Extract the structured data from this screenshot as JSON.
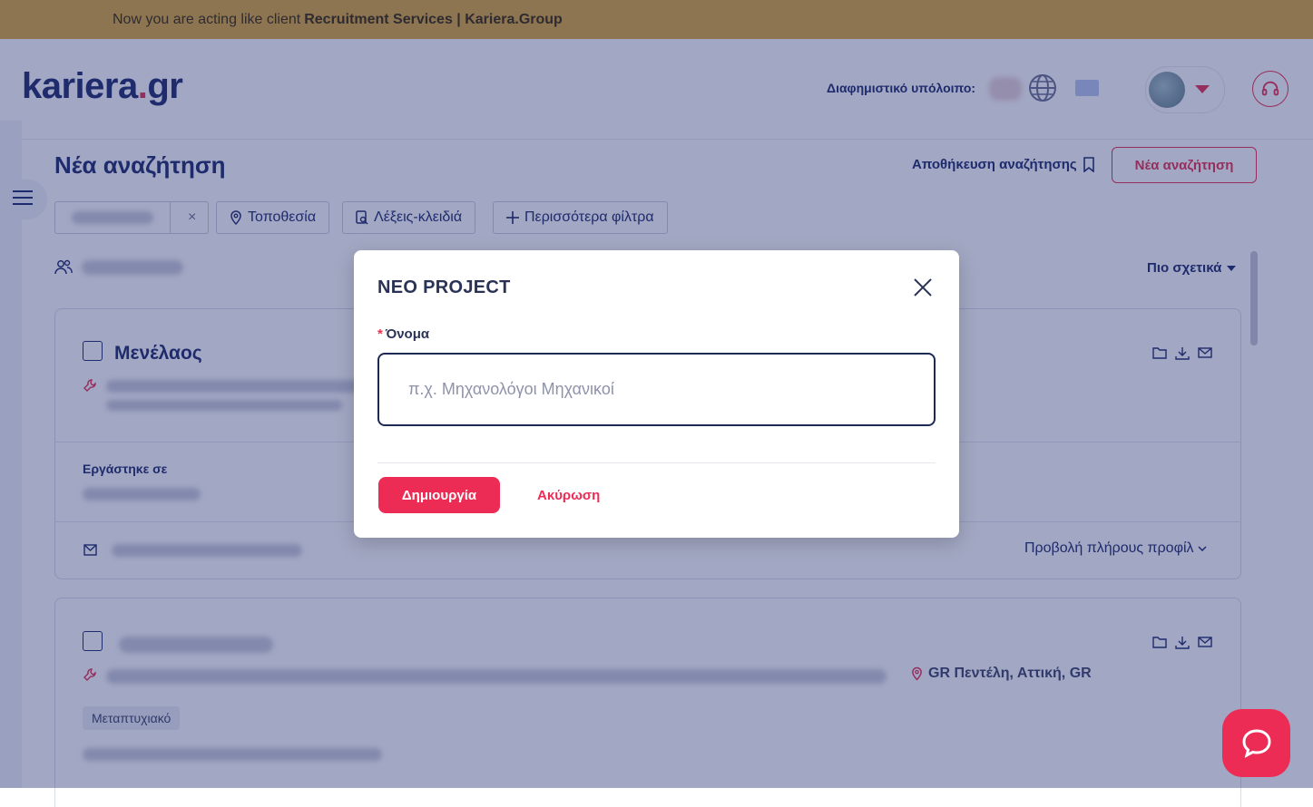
{
  "banner": {
    "prefix": "Now you are acting like client",
    "client": "Recruitment Services | Kariera.Group"
  },
  "header": {
    "logo_main": "kariera",
    "logo_dot": ".",
    "logo_tld": "gr",
    "credit_label": "Διαφημιστικό υπόλοιπο:"
  },
  "page": {
    "title": "Νέα αναζήτηση",
    "save_search": "Αποθήκευση αναζήτησης",
    "new_search": "Νέα αναζήτηση"
  },
  "filters": {
    "clear": "×",
    "location": "Τοποθεσία",
    "keywords": "Λέξεις-κλειδιά",
    "more": "Περισσότερα φίλτρα"
  },
  "sort": {
    "label": "Πιο σχετικά"
  },
  "cards": [
    {
      "name": "Μενέλαος",
      "worked_label": "Εργάστηκε σε",
      "view_profile": "Προβολή πλήρους προφίλ"
    },
    {
      "location": "GR Πεντέλη, Αττική, GR",
      "tag": "Μεταπτυχιακό"
    }
  ],
  "modal": {
    "title": "ΝΕΟ PROJECT",
    "required_mark": "*",
    "field_label": "Όνομα",
    "input_value": "",
    "input_placeholder": "π.χ. Μηχανολόγοι Μηχανικοί",
    "create": "Δημιουργία",
    "cancel": "Ακύρωση"
  },
  "colors": {
    "brand_navy": "#1d2a6b",
    "accent_red": "#e8304f",
    "banner": "#d9aa3a",
    "overlay": "rgba(34,46,112,0.42)"
  },
  "icons": [
    "globe-icon",
    "chevron-down-icon",
    "headset-icon",
    "menu-icon",
    "bookmark-icon",
    "location-pin-icon",
    "keyword-search-icon",
    "plus-icon",
    "users-icon",
    "sort-caret-icon",
    "folder-icon",
    "download-icon",
    "mail-icon",
    "wrench-icon",
    "close-icon",
    "chat-icon"
  ]
}
